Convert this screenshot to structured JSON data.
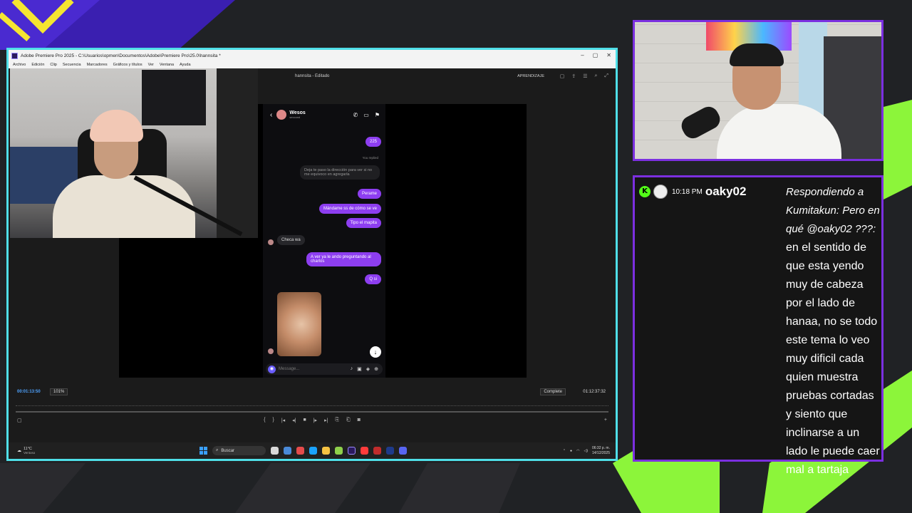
{
  "window": {
    "title": "Adobe Premiere Pro 2025 - C:\\Usuarios\\opmen\\Documentos\\Adobe\\Premiere Pro\\25.0\\hannsita *",
    "controls": [
      "–",
      "▢",
      "✕"
    ]
  },
  "menu": [
    "Archivo",
    "Edición",
    "Clip",
    "Secuencia",
    "Marcadores",
    "Gráficos y títulos",
    "Ver",
    "Ventana",
    "Ayuda"
  ],
  "panel": {
    "doc_title": "hannsita - Editado",
    "learn_label": "APRENDIZAJE"
  },
  "phone": {
    "contact_name": "Wesos",
    "contact_sub": "seccond",
    "you_replied": "You replied",
    "messages": [
      {
        "type": "out",
        "text": "225"
      },
      {
        "type": "reply",
        "text": "Deja te paso la dirección para ver si no me equivoco en agregarla"
      },
      {
        "type": "out",
        "text": "Perame"
      },
      {
        "type": "out",
        "text": "Mándame ss de cómo se ve"
      },
      {
        "type": "out",
        "text": "Tipo el mapita"
      },
      {
        "type": "in",
        "text": "Checa wa"
      },
      {
        "type": "out",
        "text": "A ver ya le ando preguntando al charlos"
      },
      {
        "type": "out",
        "text": "Q si"
      }
    ],
    "input_placeholder": "Message..."
  },
  "timeline": {
    "timecode_left": "00:01:13:50",
    "zoom": "101%",
    "quality": "Complete",
    "timecode_right": "01:12:37:32"
  },
  "taskbar": {
    "temp": "11°C",
    "weather": "Ventoso",
    "search_label": "Buscar",
    "time": "06:32 p. m.",
    "date": "14/12/2025"
  },
  "chat": {
    "time": "10:18 PM",
    "username": "oaky02",
    "reply_prefix": "Respondiendo a Kumitakun: Pero en qué @oaky02 ???:",
    "message": "en el sentido de que esta yendo muy de cabeza por el lado de hanaa, no se todo este tema lo veo muy dificil cada quien muestra pruebas cortadas y siento que inclinarse a un lado le puede caer mal a tartaja"
  },
  "colors": {
    "screen_border": "#4fdfe8",
    "panel_border": "#7b2fe0",
    "accent_green": "#53fc18",
    "message_purple": "#8d3ef0"
  }
}
